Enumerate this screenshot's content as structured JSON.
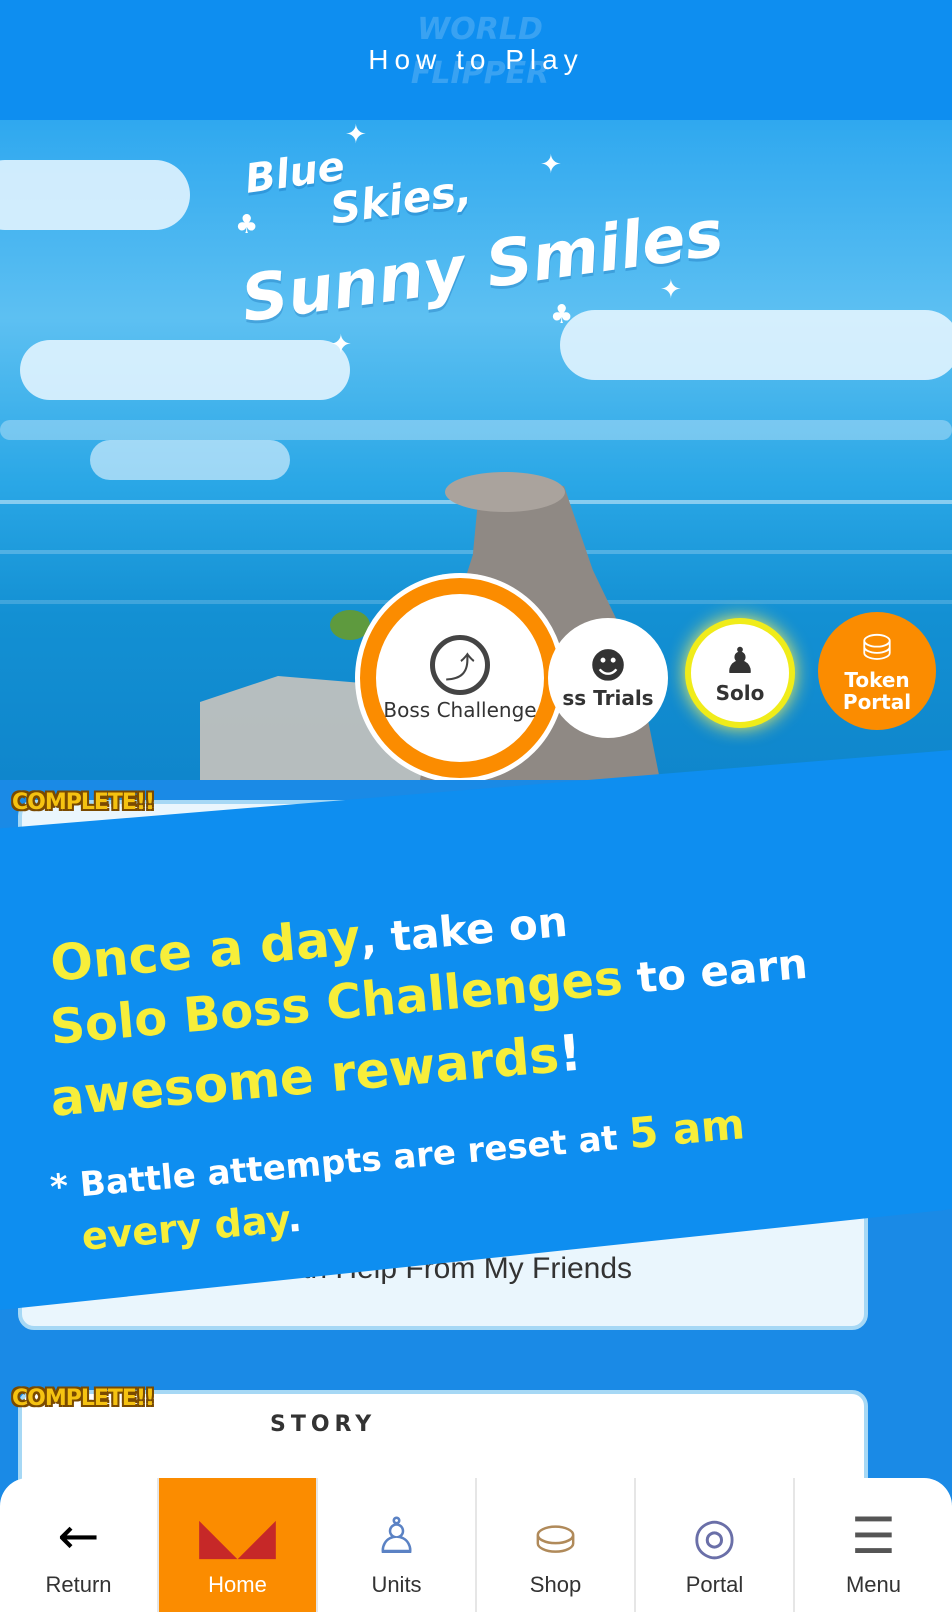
{
  "header": {
    "title": "How to Play",
    "logo_text": "WORLD FLIPPER"
  },
  "banner": {
    "line1": "Blue",
    "line2": "Skies,",
    "line3": "Sunny Smiles"
  },
  "modes": {
    "boss_challenge": "Boss Challenge",
    "boss_trials": "ss Trials",
    "solo": "Solo",
    "token_portal": "Token Portal"
  },
  "cards": {
    "complete_1": "COMPLETE!!",
    "friends_label": "With Help From My Friends",
    "complete_2": "COMPLETE!!",
    "story_label": "STORY"
  },
  "promo": {
    "p1_yellow": "Once a day",
    "p1_white": ", take on",
    "p2_yellow": "Solo Boss Challenges",
    "p2_white": " to earn",
    "p3_yellow": "awesome rewards",
    "p3_white": "!",
    "note_white": "* Battle attempts are reset at ",
    "note_yellow": "5 am",
    "note2_yellow": "every day",
    "note2_white": "."
  },
  "nav": [
    {
      "label": "Return",
      "icon": "back-arrow-icon"
    },
    {
      "label": "Home",
      "icon": "flipper-icon"
    },
    {
      "label": "Units",
      "icon": "unit-icon"
    },
    {
      "label": "Shop",
      "icon": "shop-bag-icon"
    },
    {
      "label": "Portal",
      "icon": "portal-gate-icon"
    },
    {
      "label": "Menu",
      "icon": "menu-list-icon"
    }
  ],
  "colors": {
    "primary_blue": "#0e8ef0",
    "accent_orange": "#fb8c00",
    "highlight_yellow": "#f7ee3a",
    "solo_glow": "#f0ec1a"
  }
}
